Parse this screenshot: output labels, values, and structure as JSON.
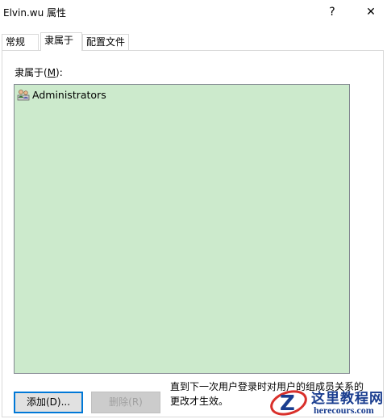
{
  "window": {
    "title": "Elvin.wu 属性",
    "help_glyph": "?",
    "close_glyph": "✕"
  },
  "tabs": [
    {
      "label": "常规",
      "active": false
    },
    {
      "label": "隶属于",
      "active": true
    },
    {
      "label": "配置文件",
      "active": false
    }
  ],
  "member_of": {
    "label_prefix": "隶属于(",
    "label_mnemonic": "M",
    "label_suffix": "):",
    "items": [
      {
        "name": "Administrators",
        "icon": "group-icon"
      }
    ]
  },
  "buttons": {
    "add_label": "添加(D)...",
    "remove_label": "删除(R)"
  },
  "note": {
    "text": "直到下一次用户登录时对用户的组成员关系的更改才生效。"
  },
  "watermark": {
    "title": "这里教程网",
    "subtitle": "herecours.com"
  },
  "colors": {
    "list_background": "#cceacc",
    "focus_border": "#0078d7",
    "watermark_blue": "#1a3d8f",
    "watermark_red": "#d9302b"
  }
}
